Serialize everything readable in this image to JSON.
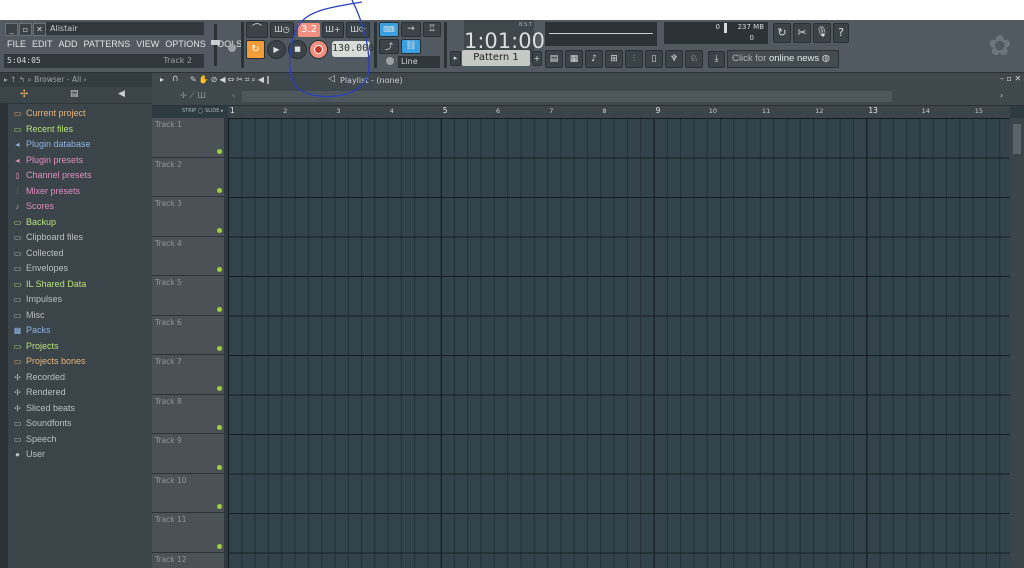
{
  "window": {
    "title_field": "Alistair",
    "menu": [
      "FILE",
      "EDIT",
      "ADD",
      "PATTERNS",
      "VIEW",
      "OPTIONS",
      "TOOLS",
      "?"
    ],
    "time_hint": "5:04:05",
    "track_hint": "Track 2"
  },
  "transport": {
    "pattern_number": "3.2",
    "tempo": "130.000",
    "song_position": "1:01:00",
    "bst": "B:S:T",
    "snap": "Line",
    "pattern_select": "Pattern 1",
    "mem": "237 MB",
    "cpu_top": "0",
    "cpu_bottom": "0",
    "online_news_prefix": "Click for",
    "online_news": "online news"
  },
  "browser": {
    "header": "Browser - All",
    "items": [
      {
        "label": "Current project",
        "color": "#e8b27a",
        "icon": "folder-icon"
      },
      {
        "label": "Recent files",
        "color": "#b7e07a",
        "icon": "folder-icon"
      },
      {
        "label": "Plugin database",
        "color": "#8fb3e6",
        "icon": "plugin-icon"
      },
      {
        "label": "Plugin presets",
        "color": "#e28ec0",
        "icon": "plugin-icon"
      },
      {
        "label": "Channel presets",
        "color": "#e28ec0",
        "icon": "channel-icon"
      },
      {
        "label": "Mixer presets",
        "color": "#e28ec0",
        "icon": "mixer-icon"
      },
      {
        "label": "Scores",
        "color": "#e28ec0",
        "icon": "note-icon"
      },
      {
        "label": "Backup",
        "color": "#b7e07a",
        "icon": "folder-icon"
      },
      {
        "label": "Clipboard files",
        "color": "#b8c0c4",
        "icon": "folder-icon"
      },
      {
        "label": "Collected",
        "color": "#b8c0c4",
        "icon": "folder-icon"
      },
      {
        "label": "Envelopes",
        "color": "#b8c0c4",
        "icon": "folder-icon"
      },
      {
        "label": "IL Shared Data",
        "color": "#b7e07a",
        "icon": "folder-icon"
      },
      {
        "label": "Impulses",
        "color": "#b8c0c4",
        "icon": "folder-icon"
      },
      {
        "label": "Misc",
        "color": "#b8c0c4",
        "icon": "folder-icon"
      },
      {
        "label": "Packs",
        "color": "#8fb3e6",
        "icon": "packs-icon"
      },
      {
        "label": "Projects",
        "color": "#b7e07a",
        "icon": "folder-icon"
      },
      {
        "label": "Projects bones",
        "color": "#e8b27a",
        "icon": "folder-icon"
      },
      {
        "label": "Recorded",
        "color": "#b8c0c4",
        "icon": "wave-icon"
      },
      {
        "label": "Rendered",
        "color": "#b8c0c4",
        "icon": "wave-icon"
      },
      {
        "label": "Sliced beats",
        "color": "#b8c0c4",
        "icon": "wave-icon"
      },
      {
        "label": "Soundfonts",
        "color": "#b8c0c4",
        "icon": "folder-icon"
      },
      {
        "label": "Speech",
        "color": "#b8c0c4",
        "icon": "folder-icon"
      },
      {
        "label": "User",
        "color": "#b8c0c4",
        "icon": "user-icon"
      }
    ]
  },
  "playlist": {
    "title": "Playlist - (none)",
    "ruler": [
      "1",
      "2",
      "3",
      "4",
      "5",
      "6",
      "7",
      "8",
      "9",
      "10",
      "11",
      "12",
      "13",
      "14",
      "15"
    ],
    "tracks": [
      "Track 1",
      "Track 2",
      "Track 3",
      "Track 4",
      "Track 5",
      "Track 6",
      "Track 7",
      "Track 8",
      "Track 9",
      "Track 10",
      "Track 11",
      "Track 12"
    ]
  },
  "colors": {
    "accent": "#f08f80",
    "led": "#9bd13c",
    "pen": "#2a3fbf"
  }
}
